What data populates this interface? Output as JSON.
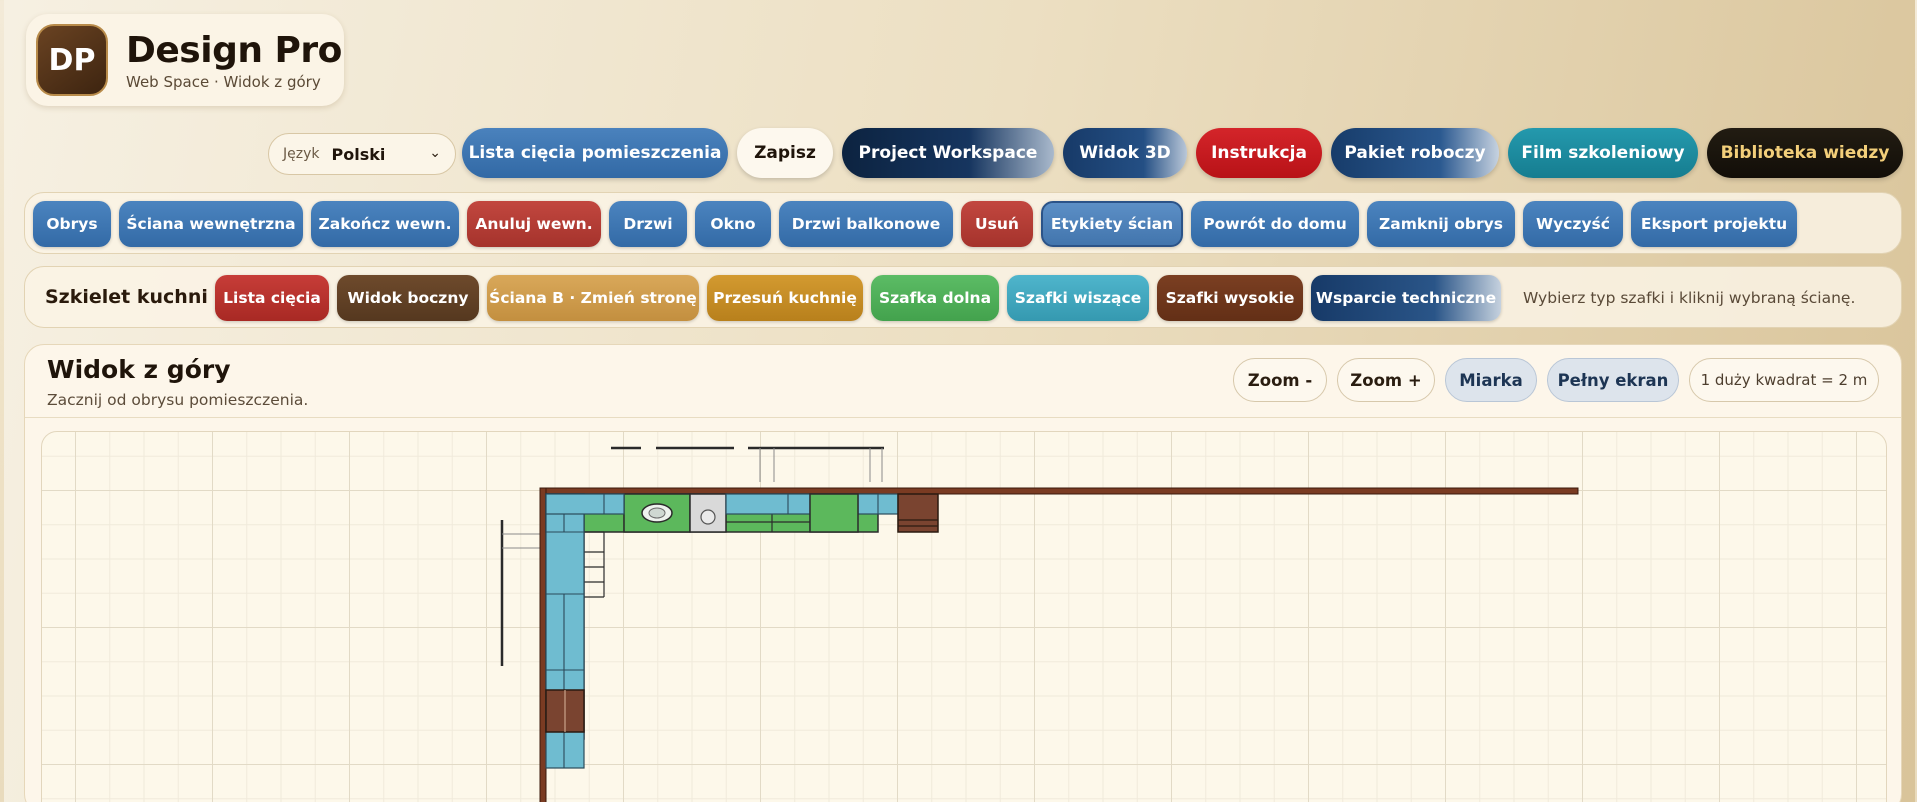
{
  "brand": {
    "logo_text": "DP",
    "title": "Design Pro",
    "subtitle": "Web Space · Widok z góry"
  },
  "language": {
    "label": "Język",
    "value": "Polski"
  },
  "top_nav": [
    {
      "label": "Lista cięcia pomieszczenia",
      "color": "#3d74b0"
    },
    {
      "label": "Zapisz",
      "color": "#fdf8ee"
    },
    {
      "label": "Project Workspace",
      "color": "#0f2a4e"
    },
    {
      "label": "Widok 3D",
      "color": "#1c3f70"
    },
    {
      "label": "Instrukcja",
      "color": "#c4161c"
    },
    {
      "label": "Pakiet roboczy",
      "color": "#1f4c80"
    },
    {
      "label": "Film szkoleniowy",
      "color": "#1f8b9e"
    },
    {
      "label": "Biblioteka wiedzy",
      "color": "#1c1710"
    }
  ],
  "toolbar": [
    {
      "label": "Obrys"
    },
    {
      "label": "Ściana wewnętrzna"
    },
    {
      "label": "Zakończ wewn."
    },
    {
      "label": "Anuluj wewn."
    },
    {
      "label": "Drzwi"
    },
    {
      "label": "Okno"
    },
    {
      "label": "Drzwi balkonowe"
    },
    {
      "label": "Usuń"
    },
    {
      "label": "Etykiety ścian"
    },
    {
      "label": "Powrót do domu"
    },
    {
      "label": "Zamknij obrys"
    },
    {
      "label": "Wyczyść"
    },
    {
      "label": "Eksport projektu"
    }
  ],
  "kitchen": {
    "title": "Szkielet kuchni",
    "buttons": [
      {
        "label": "Lista cięcia"
      },
      {
        "label": "Widok boczny"
      },
      {
        "label": "Ściana B · Zmień stronę"
      },
      {
        "label": "Przesuń kuchnię"
      },
      {
        "label": "Szafka dolna"
      },
      {
        "label": "Szafki wiszące"
      },
      {
        "label": "Szafki wysokie"
      },
      {
        "label": "Wsparcie techniczne"
      }
    ],
    "hint": "Wybierz typ szafki i kliknij wybraną ścianę."
  },
  "view": {
    "title": "Widok z góry",
    "subtitle": "Zacznij od obrysu pomieszczenia.",
    "zoom_out": "Zoom -",
    "zoom_in": "Zoom +",
    "measure": "Miarka",
    "fullscreen": "Pełny ekran",
    "scale": "1 duży kwadrat = 2 m"
  },
  "colors": {
    "wall": "#7a3b22",
    "base_cabinet": "#5cb85c",
    "wall_cabinet": "#6fb8cc",
    "tall_cabinet": "#7a4430"
  }
}
